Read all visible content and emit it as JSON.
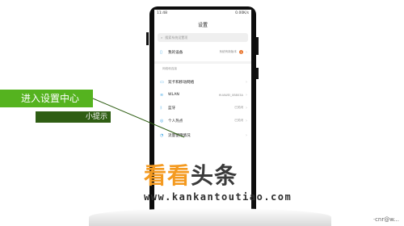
{
  "status_bar": {
    "time": "11:48",
    "network": "0.00K/s",
    "battery_pct": "⚡"
  },
  "screen": {
    "title": "设置",
    "search_placeholder": "搜索系统设置项"
  },
  "my_device": {
    "label": "我的设备",
    "value": "系统有新版本",
    "badge": "1"
  },
  "section_network": "网络和连接",
  "rows": [
    {
      "label": "双卡和移动网络",
      "value": ""
    },
    {
      "label": "WLAN",
      "value": "HUAWEI_0B803A"
    },
    {
      "label": "蓝牙",
      "value": "已关闭"
    },
    {
      "label": "个人热点",
      "value": "已关闭"
    },
    {
      "label": "流量使用情况",
      "value": ""
    }
  ],
  "tip": {
    "main": "进入设置中心",
    "sub": "小提示"
  },
  "watermark": {
    "brand_a": "看看",
    "brand_b": "头条",
    "url": "www.kankantoutiao.com"
  },
  "corner": "·cnr@w..."
}
